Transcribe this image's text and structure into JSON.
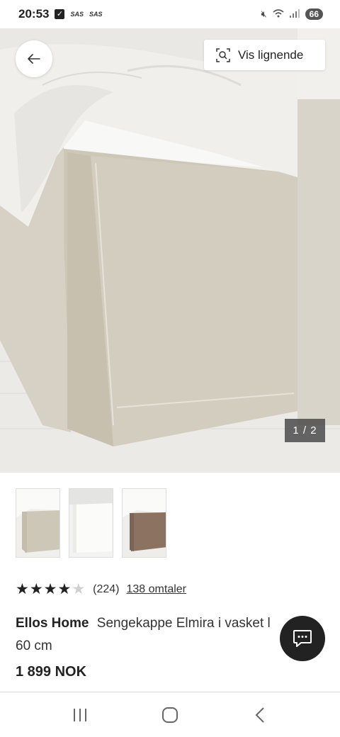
{
  "status_bar": {
    "time": "20:53",
    "sas_1": "SAS",
    "sas_2": "SAS",
    "battery": "66"
  },
  "toolbar": {
    "back_icon": "arrow-left-icon",
    "similar_label": "Vis lignende",
    "similar_icon": "visual-search-icon"
  },
  "gallery": {
    "counter": "1 / 2",
    "thumbnails": [
      "natural linen bed skirt",
      "white linen bed skirt",
      "brown linen bed skirt"
    ]
  },
  "product": {
    "rating": 4,
    "rating_max": 5,
    "rating_count": "(224)",
    "reviews_link": "138 omtaler",
    "brand": "Ellos Home",
    "name": "Sengekappe Elmira i vasket l",
    "name_cont": "60 cm",
    "price": "1 899 NOK"
  },
  "chat": {
    "icon": "chat-icon"
  },
  "nav": {
    "recents_icon": "recents-icon",
    "home_icon": "home-icon",
    "back_icon": "back-icon"
  },
  "colors": {
    "accent": "#222222",
    "linen": "#cfc9bb",
    "duvet": "#f2f1ee"
  }
}
